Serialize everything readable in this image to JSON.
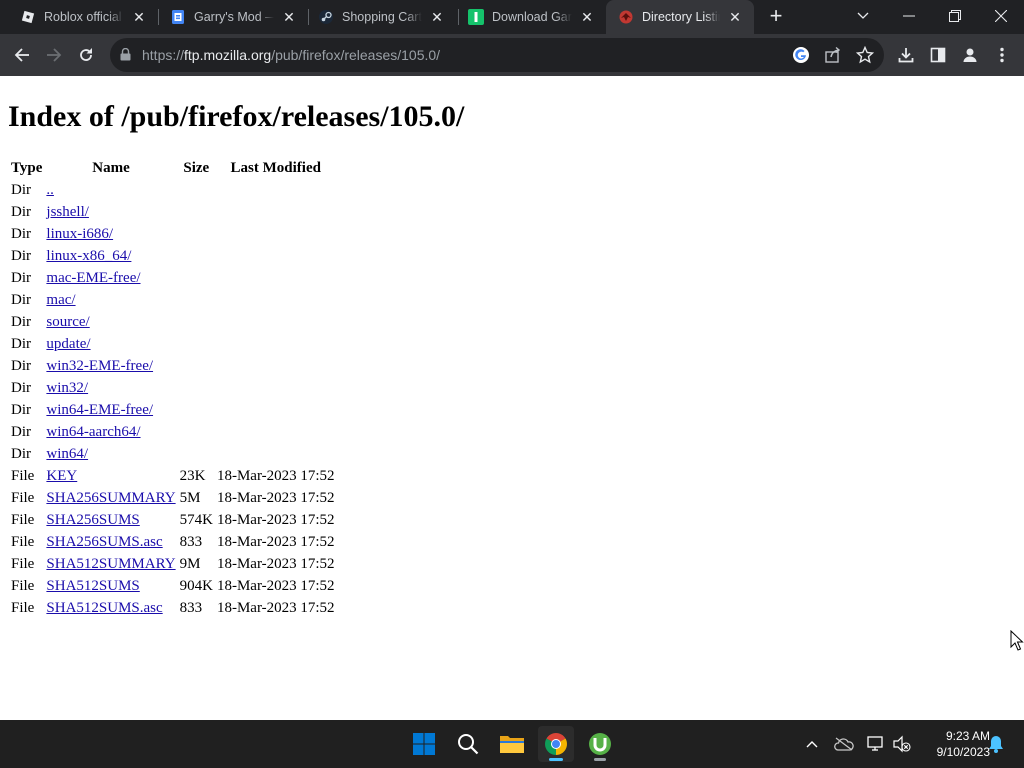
{
  "browser": {
    "tabs": [
      {
        "title": "Roblox official w",
        "favicon": "roblox-icon",
        "active": false
      },
      {
        "title": "Garry's Mod —",
        "favicon": "google-docs-icon",
        "active": false
      },
      {
        "title": "Shopping Cart",
        "favicon": "steam-icon",
        "active": false
      },
      {
        "title": "Download Garry",
        "favicon": "green-i-icon",
        "active": false
      },
      {
        "title": "Directory Listing",
        "favicon": "mozilla-icon",
        "active": true
      }
    ],
    "url": {
      "scheme": "https://",
      "host": "ftp.mozilla.org",
      "path": "/pub/firefox/releases/105.0/"
    }
  },
  "page": {
    "title": "Index of /pub/firefox/releases/105.0/",
    "columns": [
      "Type",
      "Name",
      "Size",
      "Last Modified"
    ],
    "rows": [
      {
        "type": "Dir",
        "name": "..",
        "size": "",
        "modified": ""
      },
      {
        "type": "Dir",
        "name": "jsshell/",
        "size": "",
        "modified": ""
      },
      {
        "type": "Dir",
        "name": "linux-i686/",
        "size": "",
        "modified": ""
      },
      {
        "type": "Dir",
        "name": "linux-x86_64/",
        "size": "",
        "modified": ""
      },
      {
        "type": "Dir",
        "name": "mac-EME-free/",
        "size": "",
        "modified": ""
      },
      {
        "type": "Dir",
        "name": "mac/",
        "size": "",
        "modified": ""
      },
      {
        "type": "Dir",
        "name": "source/",
        "size": "",
        "modified": ""
      },
      {
        "type": "Dir",
        "name": "update/",
        "size": "",
        "modified": ""
      },
      {
        "type": "Dir",
        "name": "win32-EME-free/",
        "size": "",
        "modified": ""
      },
      {
        "type": "Dir",
        "name": "win32/",
        "size": "",
        "modified": ""
      },
      {
        "type": "Dir",
        "name": "win64-EME-free/",
        "size": "",
        "modified": ""
      },
      {
        "type": "Dir",
        "name": "win64-aarch64/",
        "size": "",
        "modified": ""
      },
      {
        "type": "Dir",
        "name": "win64/",
        "size": "",
        "modified": ""
      },
      {
        "type": "File",
        "name": "KEY",
        "size": "23K",
        "modified": "18-Mar-2023 17:52"
      },
      {
        "type": "File",
        "name": "SHA256SUMMARY",
        "size": "5M",
        "modified": "18-Mar-2023 17:52"
      },
      {
        "type": "File",
        "name": "SHA256SUMS",
        "size": "574K",
        "modified": "18-Mar-2023 17:52"
      },
      {
        "type": "File",
        "name": "SHA256SUMS.asc",
        "size": "833",
        "modified": "18-Mar-2023 17:52"
      },
      {
        "type": "File",
        "name": "SHA512SUMMARY",
        "size": "9M",
        "modified": "18-Mar-2023 17:52"
      },
      {
        "type": "File",
        "name": "SHA512SUMS",
        "size": "904K",
        "modified": "18-Mar-2023 17:52"
      },
      {
        "type": "File",
        "name": "SHA512SUMS.asc",
        "size": "833",
        "modified": "18-Mar-2023 17:52"
      }
    ]
  },
  "taskbar": {
    "apps": [
      "windows-start-icon",
      "search-icon",
      "file-explorer-icon",
      "chrome-icon",
      "utorrent-icon"
    ],
    "active_app": "chrome-icon",
    "tray_icons": [
      "chevron-up-icon",
      "onedrive-icon",
      "network-icon",
      "volume-muted-icon",
      "notification-bell-icon"
    ],
    "clock": {
      "time": "9:23 AM",
      "date": "9/10/2023"
    }
  },
  "colors": {
    "tab_strip": "#202124",
    "toolbar": "#35363a",
    "link": "#1a0dab",
    "taskbar": "#202020",
    "win_accent": "#0078d4"
  }
}
